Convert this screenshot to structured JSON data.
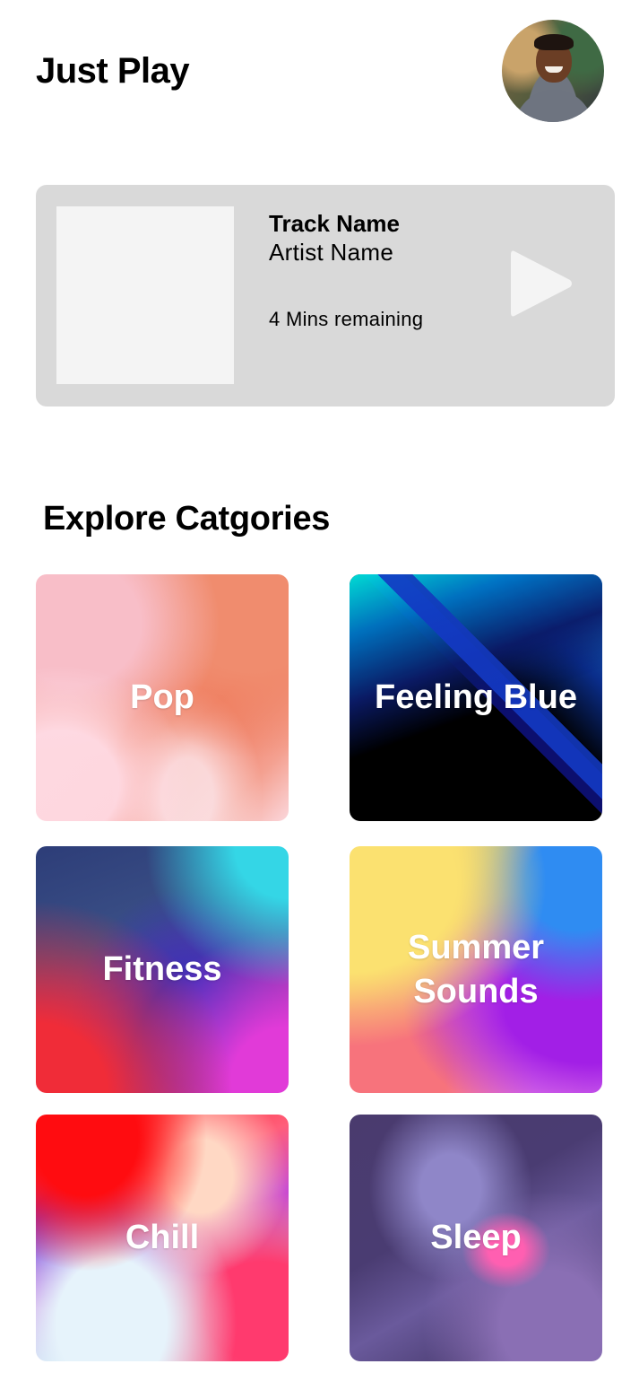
{
  "header": {
    "title": "Just Play",
    "avatar_icon": "user-avatar-photo"
  },
  "now_playing": {
    "track_name": "Track Name",
    "artist_name": "Artist Name",
    "remaining": "4 Mins remaining",
    "play_icon": "play-icon",
    "card_color": "#d9d9d9",
    "art_color": "#f4f4f4"
  },
  "explore": {
    "title": "Explore Catgories",
    "categories": [
      {
        "label": "Pop"
      },
      {
        "label": "Feeling Blue"
      },
      {
        "label": "Fitness"
      },
      {
        "label": "Summer Sounds"
      },
      {
        "label": "Chill"
      },
      {
        "label": "Sleep"
      }
    ]
  }
}
